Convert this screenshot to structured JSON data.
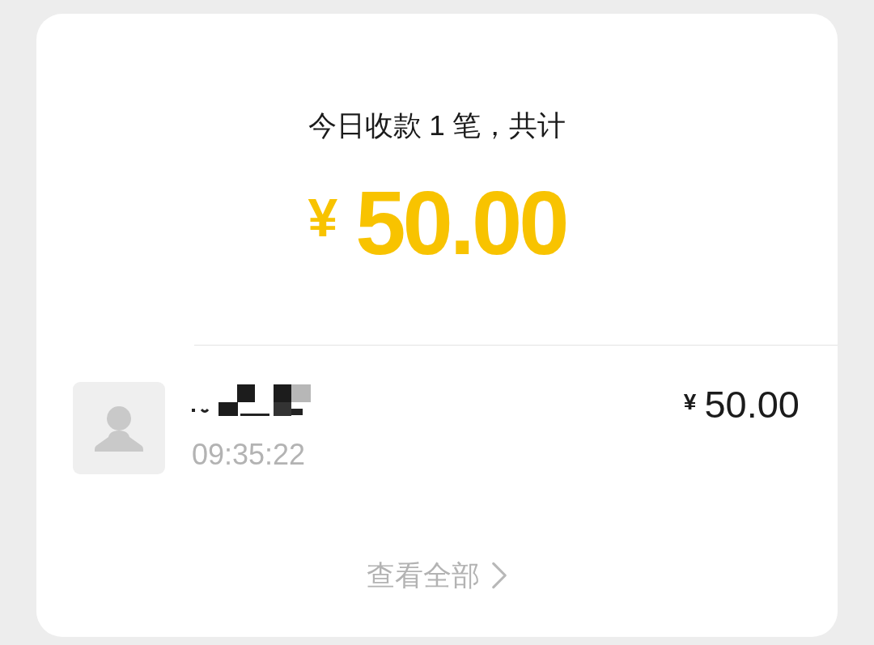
{
  "summary": {
    "title": "今日收款 1 笔，共计",
    "currency": "¥",
    "amount": "50.00"
  },
  "transactions": [
    {
      "time": "09:35:22",
      "currency": "¥",
      "amount": "50.00"
    }
  ],
  "view_all": {
    "label": "查看全部"
  }
}
